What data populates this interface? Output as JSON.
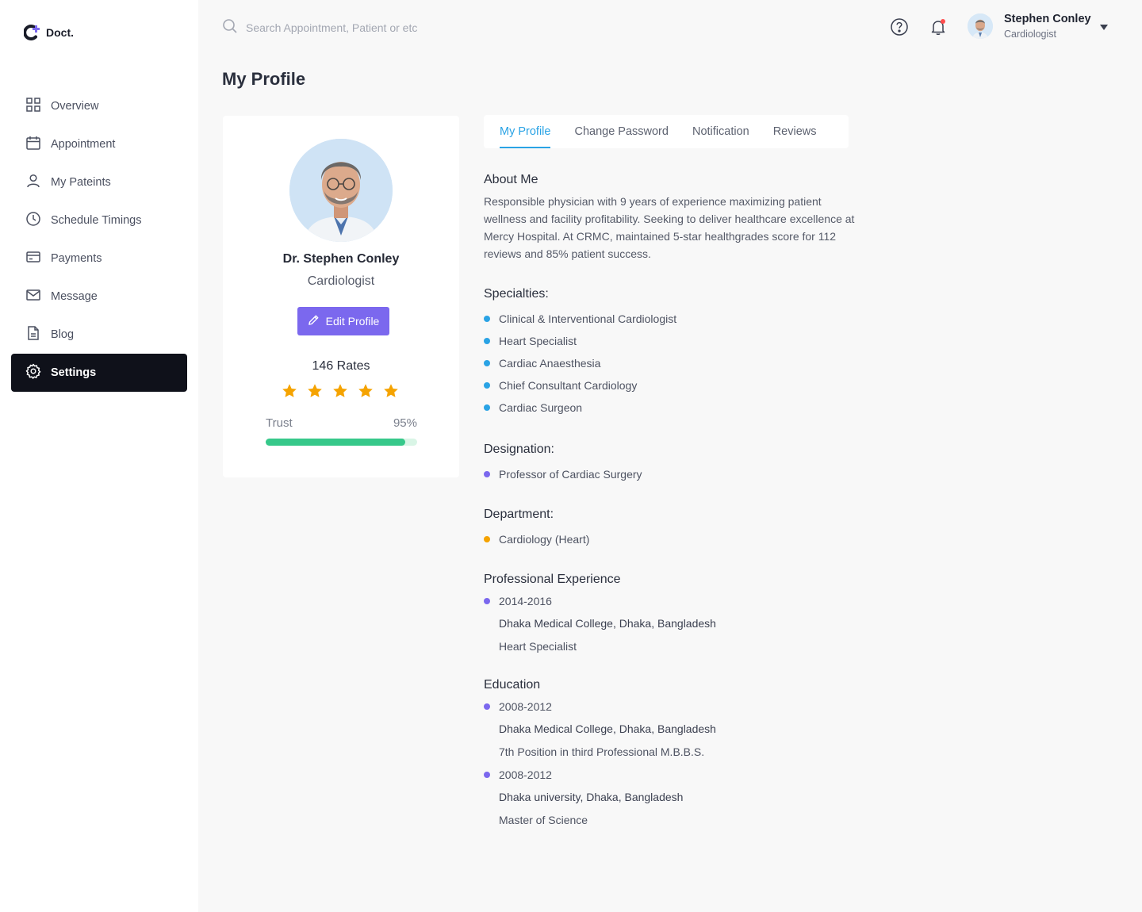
{
  "app": {
    "name": "Doct."
  },
  "sidebar": {
    "items": [
      {
        "label": "Overview",
        "icon": "grid-icon"
      },
      {
        "label": "Appointment",
        "icon": "calendar-icon"
      },
      {
        "label": "My Pateints",
        "icon": "user-icon"
      },
      {
        "label": "Schedule Timings",
        "icon": "clock-icon"
      },
      {
        "label": "Payments",
        "icon": "card-icon"
      },
      {
        "label": "Message",
        "icon": "mail-icon"
      },
      {
        "label": "Blog",
        "icon": "document-icon"
      },
      {
        "label": "Settings",
        "icon": "gear-icon",
        "active": true
      }
    ]
  },
  "header": {
    "search_placeholder": "Search Appointment, Patient or etc",
    "user": {
      "name": "Stephen Conley",
      "role": "Cardiologist"
    }
  },
  "page": {
    "title": "My Profile"
  },
  "profile_card": {
    "name": "Dr.  Stephen Conley",
    "role": "Cardiologist",
    "edit_label": "Edit Profile",
    "rates_label": "146 Rates",
    "stars": 5,
    "trust_label": "Trust",
    "trust_value": "95%",
    "trust_fraction": 0.92
  },
  "tabs": [
    {
      "label": "My Profile",
      "active": true
    },
    {
      "label": "Change Password"
    },
    {
      "label": "Notification"
    },
    {
      "label": "Reviews"
    }
  ],
  "details": {
    "about_title": "About Me",
    "about_text": "Responsible physician with 9 years of experience maximizing patient wellness and facility profitability. Seeking to deliver healthcare excellence at Mercy Hospital. At CRMC, maintained 5-star healthgrades score for 112 reviews and 85% patient success.",
    "specialties_title": "Specialties:",
    "specialties": [
      "Clinical & Interventional Cardiologist",
      "Heart Specialist",
      "Cardiac Anaesthesia",
      "Chief Consultant Cardiology",
      "Cardiac Surgeon"
    ],
    "designation_title": "Designation:",
    "designation": "Professor of Cardiac Surgery",
    "department_title": "Department:",
    "department": "Cardiology (Heart)",
    "experience_title": "Professional Experience",
    "experience": [
      {
        "years": "2014-2016",
        "place": "Dhaka Medical College, Dhaka, Bangladesh",
        "role": "Heart Specialist"
      }
    ],
    "education_title": "Education",
    "education": [
      {
        "years": "2008-2012",
        "place": "Dhaka Medical College, Dhaka, Bangladesh",
        "note": "7th Position in third Professional M.B.B.S."
      },
      {
        "years": "2008-2012",
        "place": "Dhaka university, Dhaka, Bangladesh",
        "note": "Master of Science"
      }
    ]
  },
  "colors": {
    "accent_blue": "#2aa3e5",
    "accent_purple": "#7b68ee",
    "accent_orange": "#f5a300",
    "trust_green": "#36c88a",
    "sidebar_active": "#0f111a"
  }
}
